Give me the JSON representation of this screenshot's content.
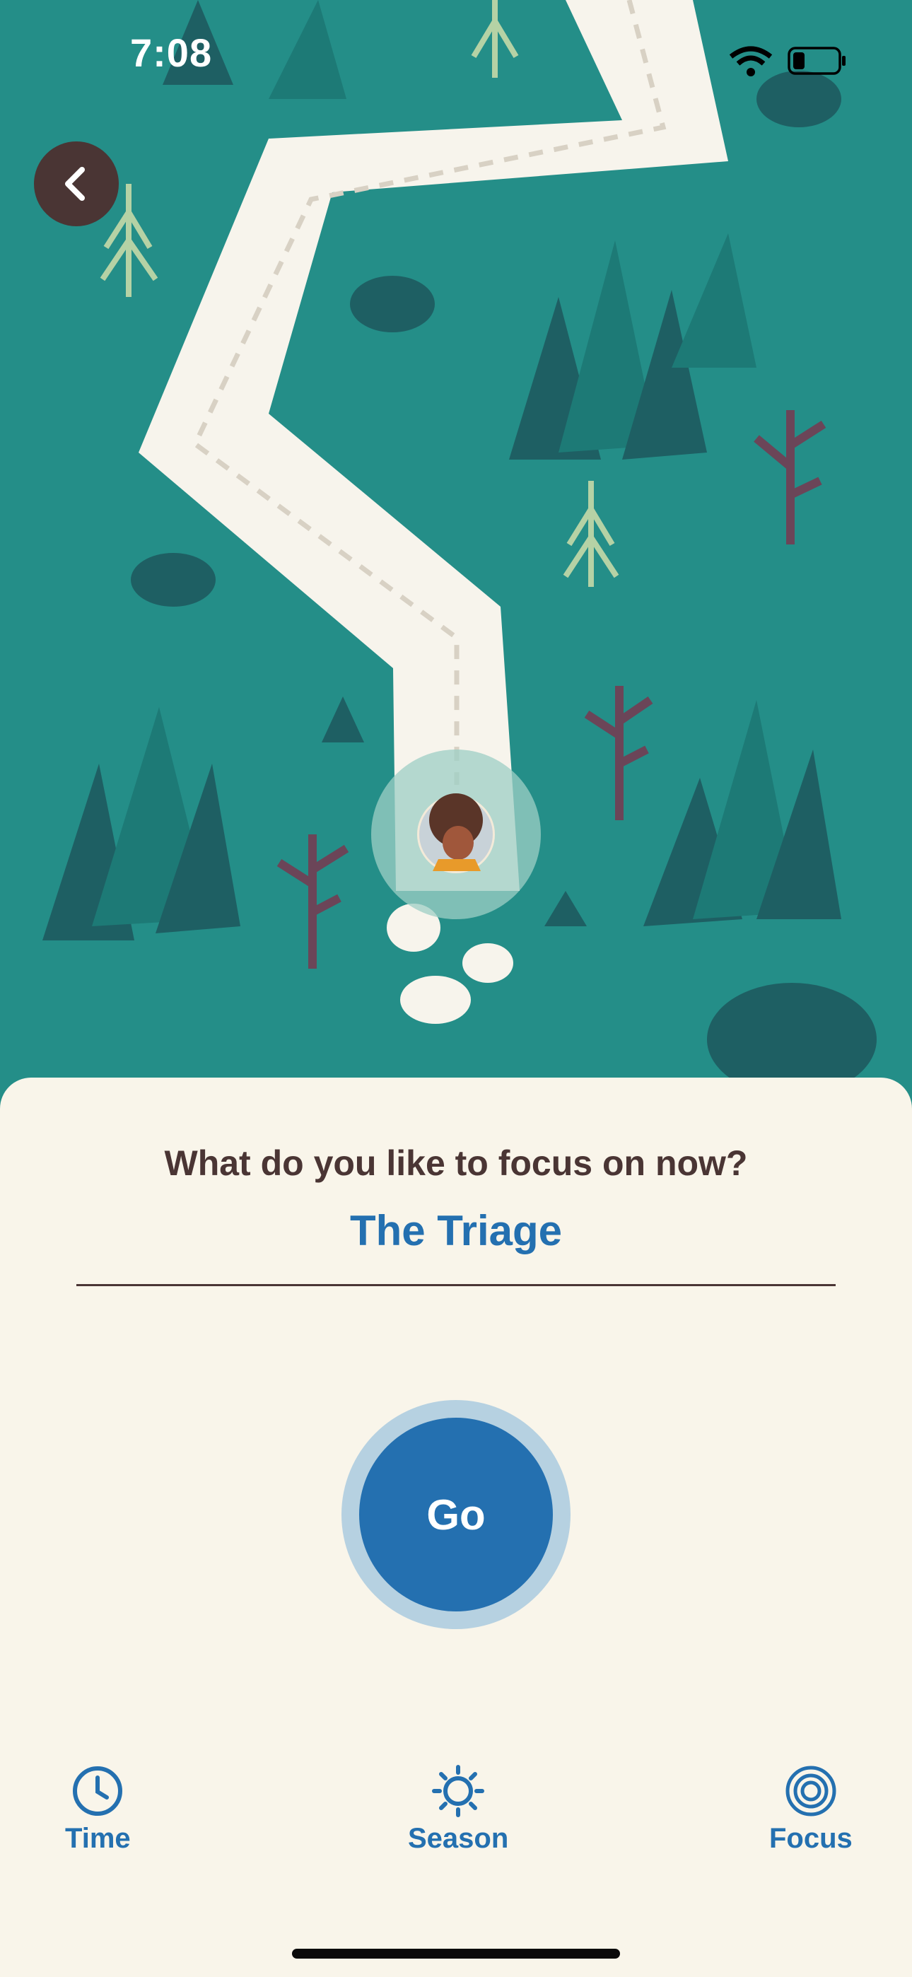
{
  "status_bar": {
    "time": "7:08"
  },
  "icons": {
    "back": "chevron-left-icon",
    "wifi": "wifi-icon",
    "battery": "battery-low-icon",
    "time_tab": "clock-icon",
    "season_tab": "sun-icon",
    "focus_tab": "target-icon"
  },
  "sheet": {
    "question": "What do you like to focus on now?",
    "focus_value": "The Triage",
    "go_label": "Go"
  },
  "tabs": [
    {
      "label": "Time"
    },
    {
      "label": "Season"
    },
    {
      "label": "Focus"
    }
  ],
  "colors": {
    "map_background": "#248e88",
    "sheet_background": "#f9f5ea",
    "accent_blue": "#2470b0",
    "dark_brown": "#4a3534"
  }
}
